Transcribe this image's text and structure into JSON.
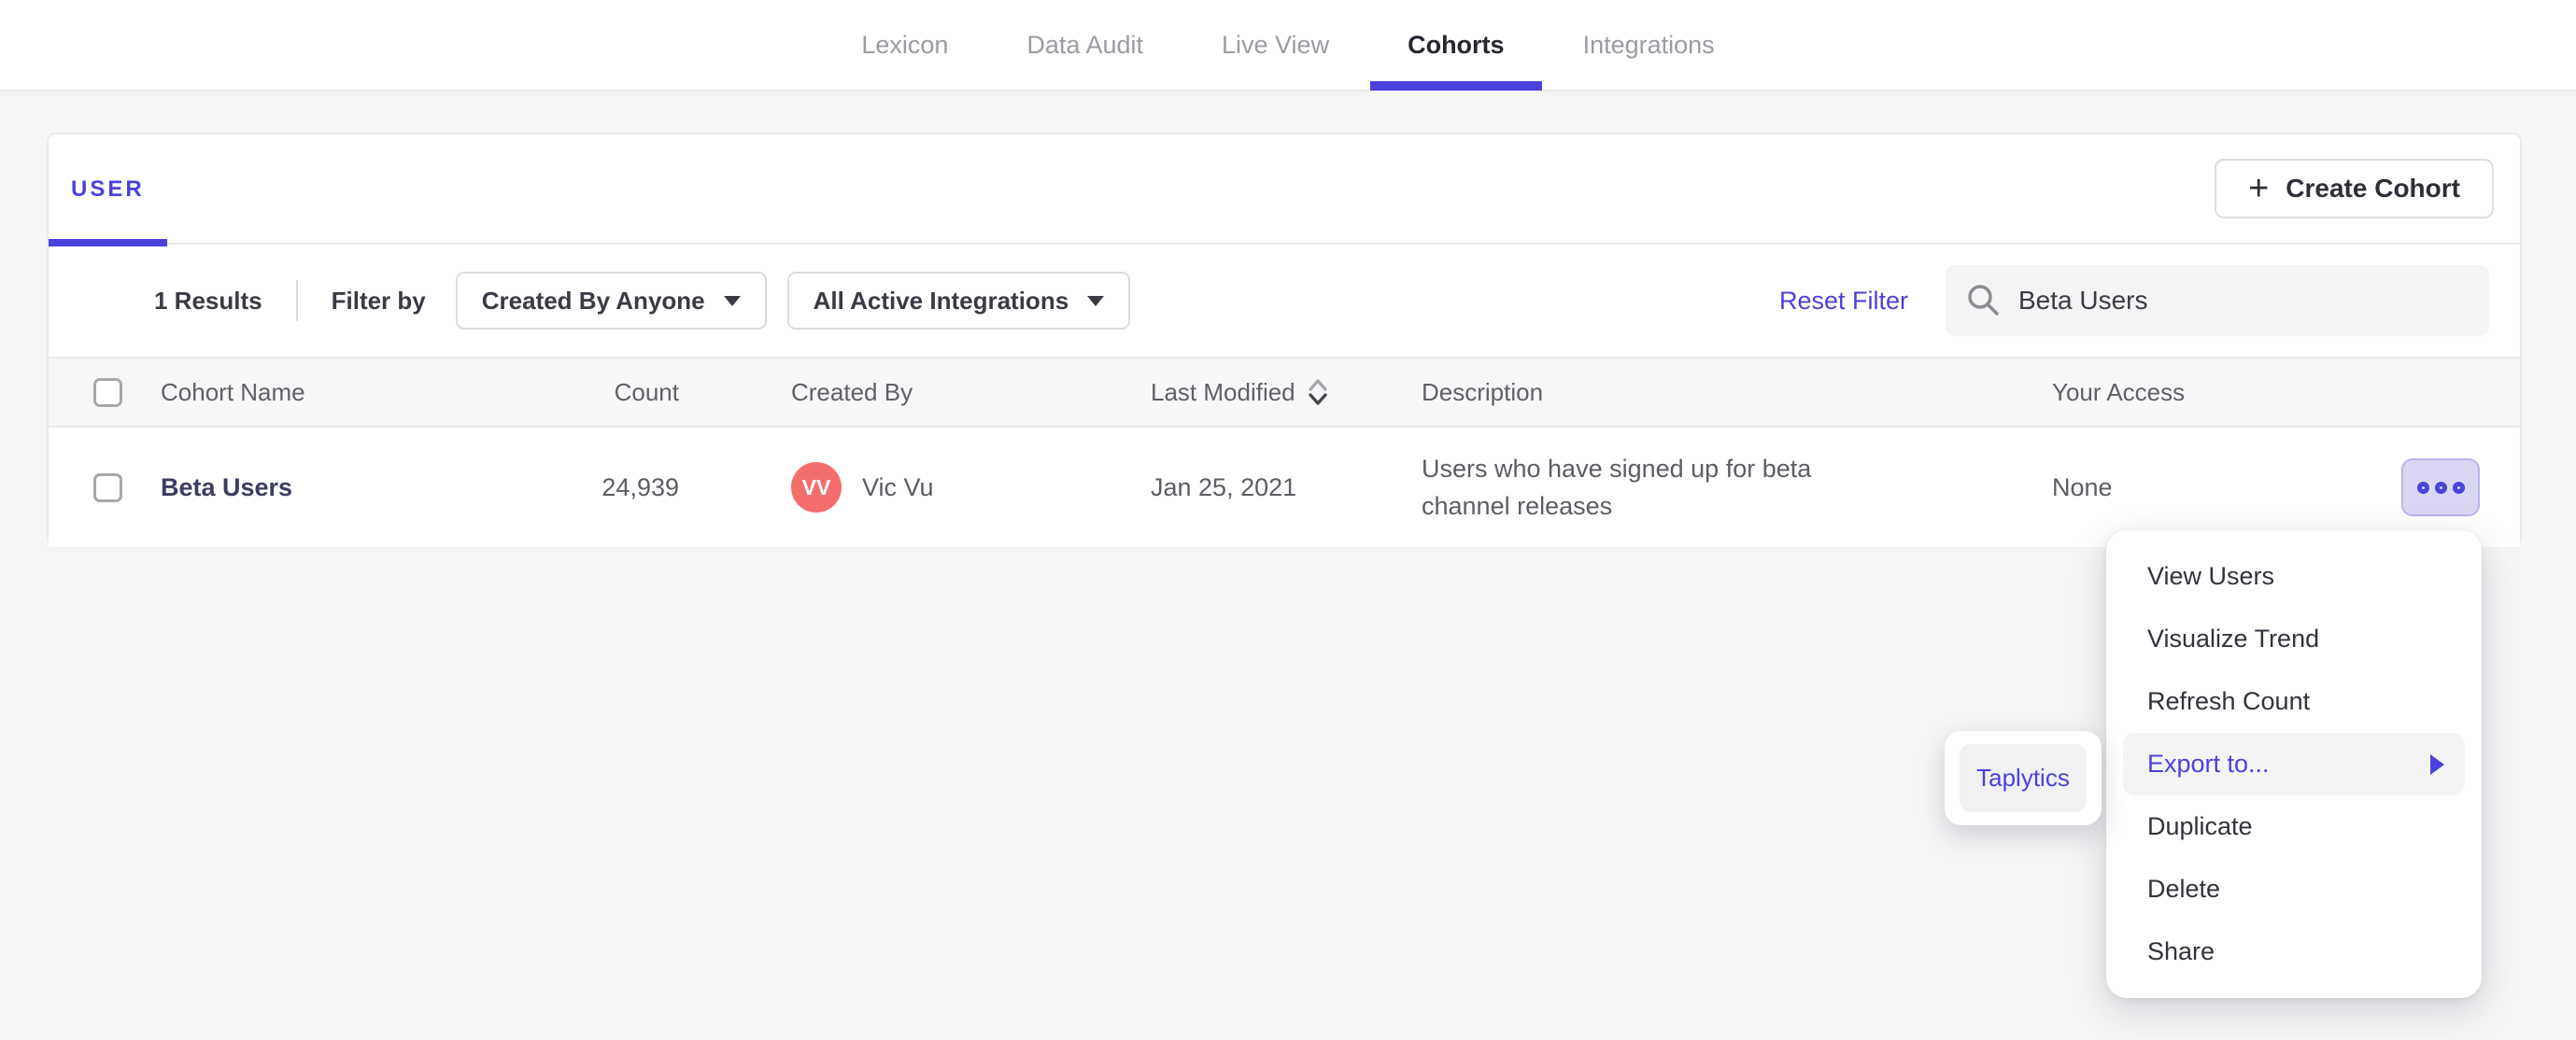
{
  "nav": {
    "items": [
      {
        "label": "Lexicon",
        "active": false
      },
      {
        "label": "Data Audit",
        "active": false
      },
      {
        "label": "Live View",
        "active": false
      },
      {
        "label": "Cohorts",
        "active": true
      },
      {
        "label": "Integrations",
        "active": false
      }
    ]
  },
  "panel": {
    "tab_label": "USER",
    "create_button": {
      "plus_glyph": "+",
      "label": "Create Cohort"
    },
    "filters": {
      "results_count": "1 Results",
      "filter_by_label": "Filter by",
      "created_by_dropdown": {
        "value": "Created By Anyone"
      },
      "integrations_dropdown": {
        "value": "All Active Integrations"
      },
      "reset_filter_label": "Reset Filter",
      "search": {
        "value": "Beta Users"
      }
    },
    "table": {
      "headers": {
        "cohort_name": "Cohort Name",
        "count": "Count",
        "created_by": "Created By",
        "last_modified": "Last Modified",
        "description": "Description",
        "your_access": "Your Access"
      },
      "rows": [
        {
          "cohort_name": "Beta Users",
          "count": "24,939",
          "creator_initials": "VV",
          "creator_name": "Vic Vu",
          "last_modified": "Jan 25, 2021",
          "description": "Users who have signed up for beta channel releases",
          "your_access": "None"
        }
      ]
    }
  },
  "context_menu": {
    "items": [
      {
        "label": "View Users",
        "highlighted": false
      },
      {
        "label": "Visualize Trend",
        "highlighted": false
      },
      {
        "label": "Refresh Count",
        "highlighted": false
      },
      {
        "label": "Export to...",
        "highlighted": true,
        "has_submenu": true
      },
      {
        "label": "Duplicate",
        "highlighted": false
      },
      {
        "label": "Delete",
        "highlighted": false
      },
      {
        "label": "Share",
        "highlighted": false
      }
    ],
    "submenu": {
      "items": [
        {
          "label": "Taplytics",
          "highlighted": true
        }
      ]
    }
  },
  "colors": {
    "accent_purple": "#4b41dc",
    "page_background": "#f5f5f6",
    "card_background": "#ffffff",
    "table_header_background": "#f7f7f8",
    "avatar_coral": "#f56e6e",
    "cohort_link_text": "#3d3c64",
    "muted_text": "#5c5c66",
    "inactive_nav_text": "#9b9ba3",
    "menu_highlight_background": "#f4f4f6",
    "ellipsis_button_background": "#dad7f5"
  }
}
